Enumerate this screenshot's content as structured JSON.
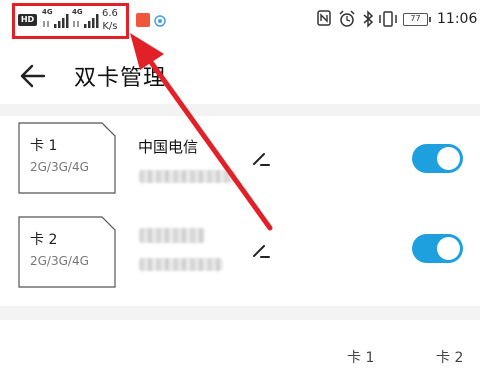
{
  "status_bar": {
    "hd_label": "HD",
    "sim1_network": "4G",
    "sim2_network": "4G",
    "speed_value": "6.6",
    "speed_unit": "K/s",
    "battery": "77",
    "time": "11:06",
    "icons": [
      "nfc-icon",
      "alarm-icon",
      "bluetooth-icon",
      "vibrate-icon"
    ],
    "highlight_color": "#e22028"
  },
  "header": {
    "title": "双卡管理"
  },
  "sim_cards": [
    {
      "card_label": "卡 1",
      "tech": "2G/3G/4G",
      "carrier": "中国电信",
      "enabled": true
    },
    {
      "card_label": "卡 2",
      "tech": "2G/3G/4G",
      "carrier": "",
      "enabled": true
    }
  ],
  "columns": {
    "card1": "卡 1",
    "card2": "卡 2"
  },
  "accent_color": "#1fa0de"
}
